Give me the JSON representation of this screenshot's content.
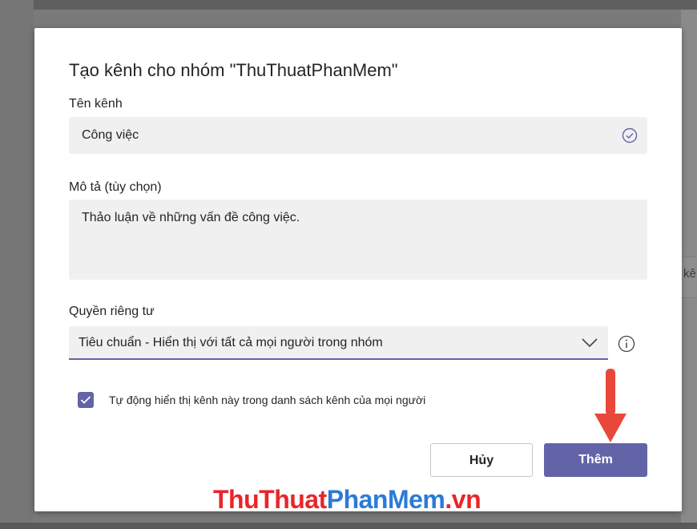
{
  "dialog": {
    "title": "Tạo kênh cho nhóm \"ThuThuatPhanMem\"",
    "channel_name": {
      "label": "Tên kênh",
      "value": "Công việc",
      "icon": "check-circle-icon"
    },
    "description": {
      "label": "Mô tả (tùy chọn)",
      "value": "Thảo luận về những vấn đề công việc."
    },
    "privacy": {
      "label": "Quyền riêng tư",
      "selected": "Tiêu chuẩn - Hiển thị với tất cả mọi người trong nhóm",
      "icon": "chevron-down-icon",
      "info_icon": "info-icon"
    },
    "auto_show": {
      "checked": true,
      "label": "Tự động hiển thị kênh này trong danh sách kênh của mọi người"
    },
    "buttons": {
      "cancel": "Hủy",
      "add": "Thêm"
    }
  },
  "background": {
    "partial_text": "kê"
  },
  "watermark": {
    "part1": "ThuThuat",
    "part2": "PhanMem",
    "part3": ".vn"
  },
  "colors": {
    "accent": "#6264a7",
    "arrow": "#e8473a",
    "input_bg": "#f0f0f0"
  }
}
